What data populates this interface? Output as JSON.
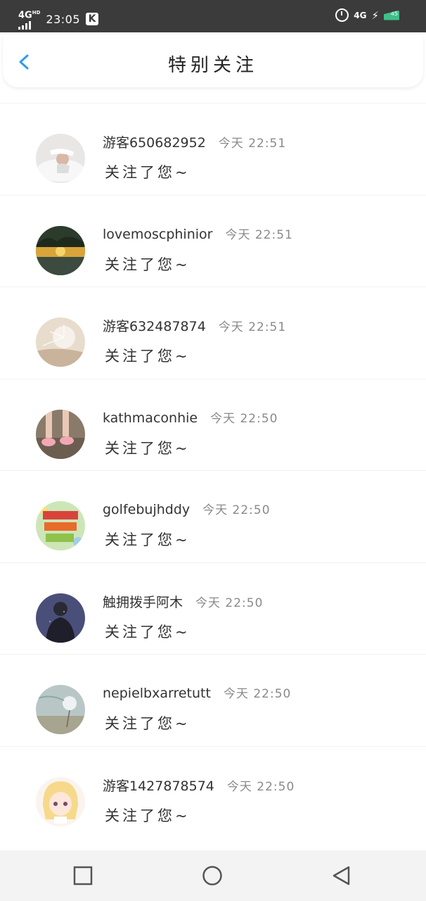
{
  "status_bar": {
    "network": "4G",
    "network_sup": "HD",
    "time": "23:05",
    "app_badge": "K",
    "right_network": "4G",
    "battery_level": "45"
  },
  "header": {
    "title": "特别关注",
    "back_icon": "chevron-left-icon"
  },
  "list": [
    {
      "name": "游客650682952",
      "time": "今天 22:51",
      "message": "关注了您~"
    },
    {
      "name": "lovemoscphinior",
      "time": "今天 22:51",
      "message": "关注了您~"
    },
    {
      "name": "游客632487874",
      "time": "今天 22:51",
      "message": "关注了您~"
    },
    {
      "name": "kathmaconhie",
      "time": "今天 22:50",
      "message": "关注了您~"
    },
    {
      "name": "golfebujhddy",
      "time": "今天 22:50",
      "message": "关注了您~"
    },
    {
      "name": "触拥拨手阿木",
      "time": "今天 22:50",
      "message": "关注了您~"
    },
    {
      "name": "nepielbxarretutt",
      "time": "今天 22:50",
      "message": "关注了您~"
    },
    {
      "name": "游客1427878574",
      "time": "今天 22:50",
      "message": "关注了您~"
    }
  ],
  "nav_bar": {
    "recents_icon": "square-icon",
    "home_icon": "circle-icon",
    "back_icon": "triangle-back-icon"
  },
  "colors": {
    "accent": "#2a9df4",
    "status_bar_bg": "#3b3b3b",
    "nav_bar_bg": "#f3f3f3"
  }
}
